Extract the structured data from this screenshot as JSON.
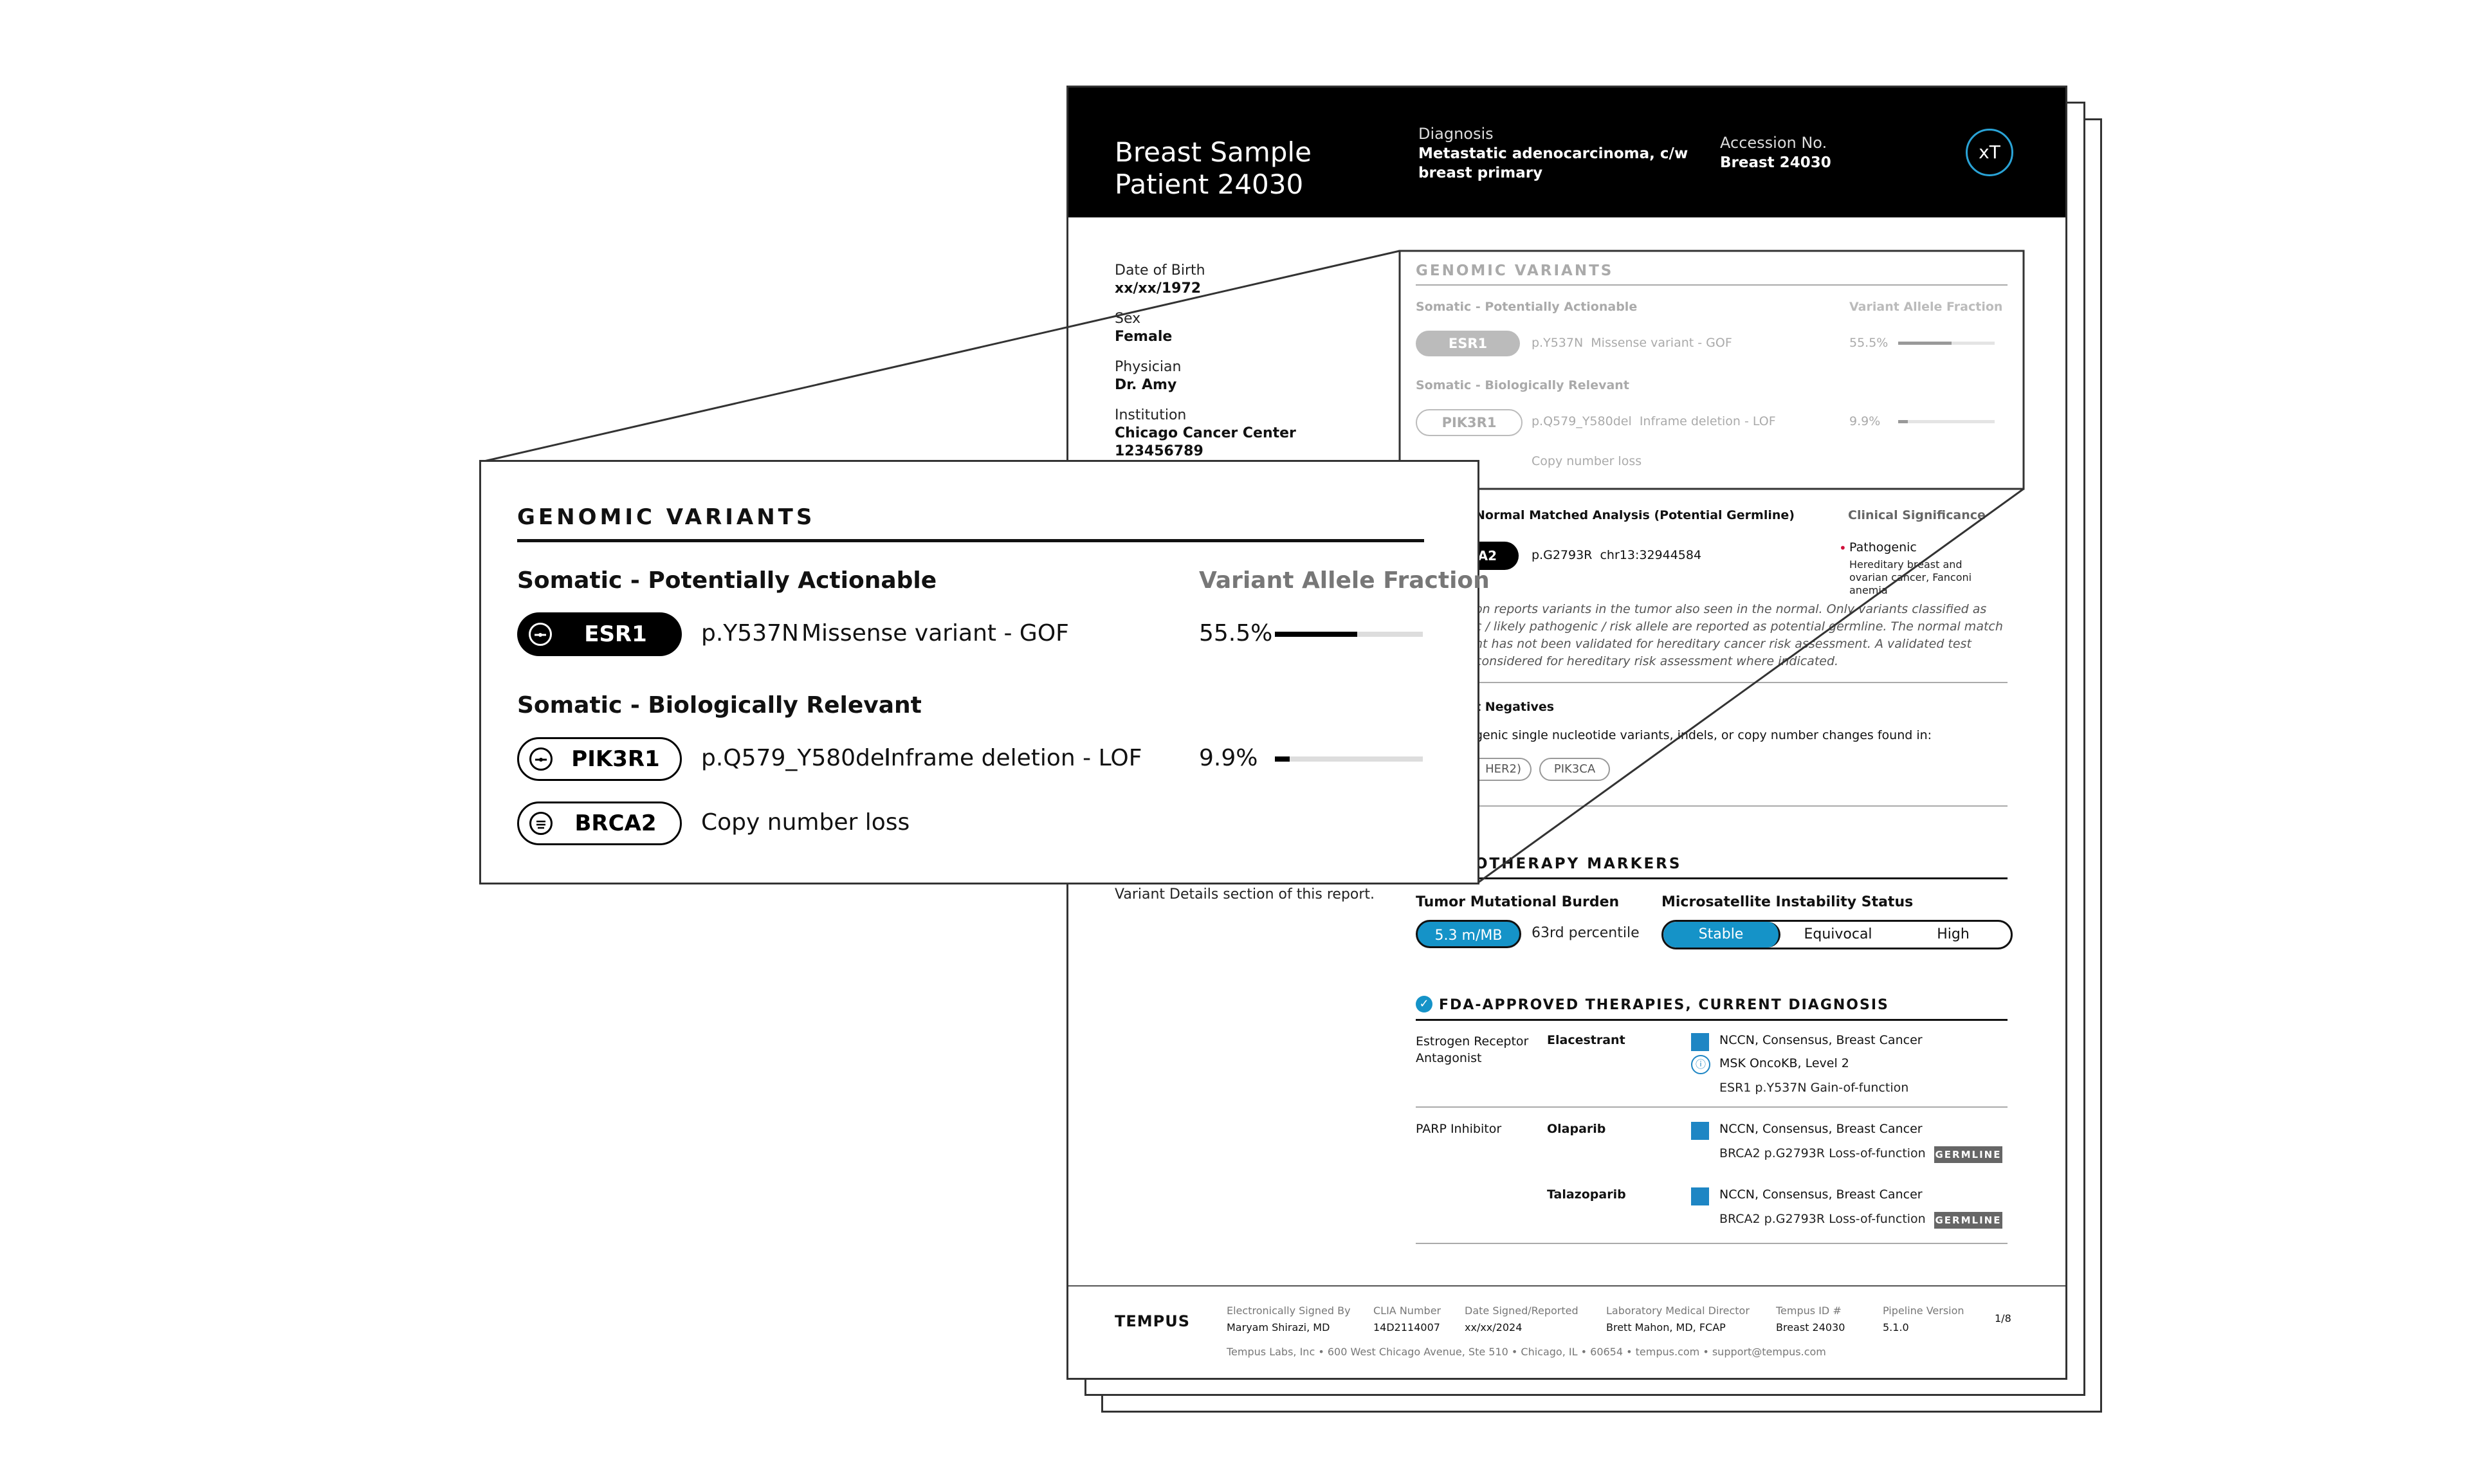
{
  "header": {
    "title_line1": "Breast Sample",
    "title_line2": "Patient 24030",
    "diagnosis_label": "Diagnosis",
    "diagnosis_value_line1": "Metastatic adenocarcinoma, c/w",
    "diagnosis_value_line2": "breast primary",
    "accession_label": "Accession No.",
    "accession_value": "Breast 24030",
    "badge": "xT"
  },
  "patient": {
    "dob_label": "Date of Birth",
    "dob_value": "xx/xx/1972",
    "sex_label": "Sex",
    "sex_value": "Female",
    "physician_label": "Physician",
    "physician_value": "Dr. Amy",
    "institution_label": "Institution",
    "institution_value": "Chicago Cancer Center",
    "institution_id": "123456789",
    "variant_note": "Variant Details section of this report."
  },
  "genomic_variants": {
    "title": "GENOMIC VARIANTS",
    "actionable_heading": "Somatic - Potentially Actionable",
    "vaf_heading": "Variant Allele Fraction",
    "relevant_heading": "Somatic - Biologically Relevant",
    "variants": [
      {
        "gene": "ESR1",
        "change": "p.Y537N",
        "effect": "Missense variant - GOF",
        "vaf_label": "55.5%",
        "vaf": 0.555
      },
      {
        "gene": "PIK3R1",
        "change": "p.Q579_Y580del",
        "effect": "Inframe deletion - LOF",
        "vaf_label": "9.9%",
        "vaf": 0.099
      },
      {
        "gene": "BRCA2",
        "change": "",
        "effect": "Copy number loss",
        "vaf_label": "",
        "vaf": null
      }
    ]
  },
  "germline": {
    "heading": "Normal Matched Analysis (Potential Germline)",
    "clinical_heading": "Clinical Significance",
    "gene": "CA2",
    "change": "p.G2793R",
    "position": "chr13:32944584",
    "significance": "Pathogenic",
    "significance_detail_1": "Hereditary breast and",
    "significance_detail_2": "ovarian cancer, Fanconi",
    "significance_detail_3": "anemia",
    "note_1": "on reports variants in the tumor also seen in the normal. Only variants classified as",
    "note_2": "c / likely pathogenic / risk allele are reported as potential germline. The normal match",
    "note_3": "nt has not been validated for hereditary cancer risk assessment. A validated test",
    "note_4": "considered for hereditary risk assessment where indicated."
  },
  "negatives": {
    "heading": "t Negatives",
    "text": "genic single nucleotide variants, indels, or copy number changes found in:",
    "chips": [
      "HER2)",
      "PIK3CA"
    ]
  },
  "immunotherapy": {
    "heading": "OTHERAPY MARKERS",
    "tmb_label": "Tumor Mutational Burden",
    "tmb_value": "5.3 m/MB",
    "tmb_percentile": "63rd percentile",
    "msi_label": "Microsatellite Instability Status",
    "msi_options": [
      "Stable",
      "Equivocal",
      "High"
    ],
    "msi_selected": "Stable"
  },
  "therapies": {
    "heading": "FDA-APPROVED THERAPIES, CURRENT DIAGNOSIS",
    "groups": [
      {
        "class_line1": "Estrogen Receptor",
        "class_line2": "Antagonist",
        "drug": "Elacestrant",
        "evidence_1": "NCCN, Consensus, Breast Cancer",
        "evidence_2": "MSK OncoKB, Level 2",
        "detail": "ESR1 p.Y537N Gain-of-function"
      },
      {
        "class_line1": "PARP Inhibitor",
        "drug": "Olaparib",
        "evidence_1": "NCCN, Consensus, Breast Cancer",
        "detail": "BRCA2 p.G2793R Loss-of-function",
        "tag": "GERMLINE"
      },
      {
        "drug": "Talazoparib",
        "evidence_1": "NCCN, Consensus, Breast Cancer",
        "detail": "BRCA2 p.G2793R Loss-of-function",
        "tag": "GERMLINE"
      }
    ]
  },
  "footer": {
    "logo": "TEMPUS",
    "signed_label": "Electronically Signed By",
    "signed_value": "Maryam Shirazi, MD",
    "clia_label": "CLIA Number",
    "clia_value": "14D2114007",
    "date_label": "Date Signed/Reported",
    "date_value": "xx/xx/2024",
    "director_label": "Laboratory Medical Director",
    "director_value": "Brett Mahon, MD, FCAP",
    "tempus_id_label": "Tempus ID #",
    "tempus_id_value": "Breast 24030",
    "pipeline_label": "Pipeline Version",
    "pipeline_value": "5.1.0",
    "page": "1/8",
    "address": "Tempus Labs, Inc • 600 West Chicago Avenue, Ste 510 • Chicago, IL • 60654 • tempus.com • support@tempus.com"
  },
  "colors": {
    "accent_blue": "#1593c8",
    "pathogenic_red": "#d0103a"
  }
}
